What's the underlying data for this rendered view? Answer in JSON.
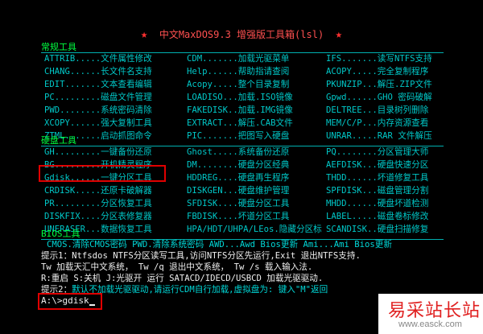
{
  "title": {
    "star": "★",
    "text": "中文MaxDOS9.3 增强版工具箱(lsl)"
  },
  "sections": [
    {
      "label": "常规工具",
      "rows": [
        [
          "ATTRIB.....文件属性修改",
          "CDM.......加载光驱菜单",
          "IFS.......读写NTFS支持"
        ],
        [
          "CHANG......长文件名支持",
          "Help......帮助指请查阅",
          "ACOPY.....完全复制程序"
        ],
        [
          "EDIT.......文本查看编辑",
          "Acopy.....整个目录复制",
          "PKUNZIP...解压.ZIP文件"
        ],
        [
          "PC.........磁盘文件管理",
          "LOADISO...加载.ISO镜像",
          "Gpwd......GHO 密码破解"
        ],
        [
          "PWD........系统密码清除",
          "FAKEDISK..加载.IMG镜像",
          "DELTREE...目录树列删除"
        ],
        [
          "XCOPY......强大复制工具",
          "EXTRACT...解压.CAB文件",
          "MEM/C/P...内存资源查看"
        ],
        [
          "ZTML.......启动抓图命令",
          "PIC.......把图写入硬盘",
          "UNRAR.....RAR 文件解压"
        ]
      ]
    },
    {
      "label": "硬盘工具",
      "rows": [
        [
          "GH.........一键备份还原",
          "Ghost.....系统备份还原",
          "PQ........分区管理大师"
        ],
        [
          "BG.........开机精灵程序",
          "DM........硬盘分区经典",
          "AEFDISK...硬盘快速分区"
        ],
        [
          "Gdisk......一键分区工具",
          "HDDREG....硬盘再生程序",
          "THDD......坏道修复工具"
        ],
        [
          "CRDISK.....还原卡破解器",
          "DISKGEN...硬盘维护管理",
          "SPFDISK...磁盘管理分割"
        ],
        [
          "PR.........分区恢复工具",
          "SFDISK....硬盘分区工具",
          "MHDD......硬盘坏道检测"
        ],
        [
          "DISKFIX....分区表修复器",
          "FBDISK....坏道分区工具",
          "LABEL.....磁盘卷标修改"
        ],
        [
          "UNERASER...数据恢复工具",
          "HPA/HDT/UHPA/LEos.隐藏分区标",
          "SCANDISK..硬盘扫描修复"
        ]
      ]
    },
    {
      "label": "BIOS工具"
    }
  ],
  "bios_line": "CMOS.清除CMOS密码  PWD.清除系统密码  AWD...Awd Bios更新  Ami...Ami Bios更新",
  "tip1": {
    "label": "提示1：",
    "text": "Ntfsdos  NTFS分区读写工具,访问NTFS分区先运行,Exit 退出NTFS支持."
  },
  "tw_line": " Tw  加载天汇中文系统， Tw /q 退出中文系统，  Tw /s 载入输入法.",
  "keys_line": " R:重启    S:关机    J:光驱开    运行 SATACD/IDECD/USBCD 加载光驱驱动.",
  "tip2": {
    "label": "提示2：",
    "text": "默认不加载光驱驱动,请运行CDM自行加载,虚拟盘为:  键入\"M\"返回"
  },
  "prompt": "A:\\>gdisk",
  "watermark": {
    "cn": "易采站长站",
    "url": "www.easck.com"
  }
}
